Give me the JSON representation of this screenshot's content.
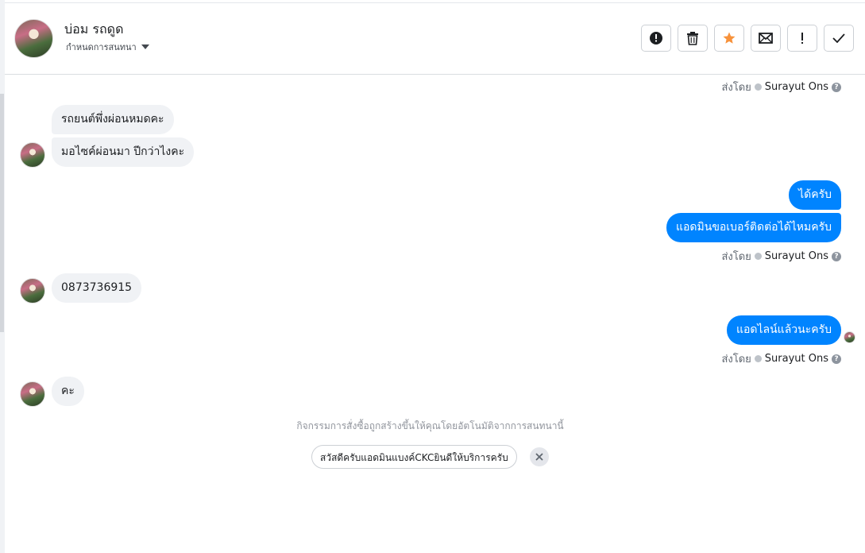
{
  "header": {
    "contact_name": "บ่อม รถดูด",
    "assign_label": "กำหนดการสนทนา",
    "avatar_icon": "user-avatar"
  },
  "toolbar": [
    {
      "name": "spam-button",
      "icon": "alert-circle-icon",
      "title": ""
    },
    {
      "name": "delete-button",
      "icon": "trash-icon",
      "title": ""
    },
    {
      "name": "star-button",
      "icon": "star-icon",
      "title": ""
    },
    {
      "name": "mark-unread-button",
      "icon": "envelope-icon",
      "title": ""
    },
    {
      "name": "follow-up-button",
      "icon": "exclamation-icon",
      "title": ""
    },
    {
      "name": "mark-done-button",
      "icon": "checkmark-icon",
      "title": ""
    }
  ],
  "sent_by_prefix": "ส่งโดย",
  "sent_by_agent": "Surayut Ons",
  "messages": {
    "m1": "รถยนต์พึ่งผ่อนหมดคะ",
    "m2": "มอไซค์ผ่อนมา ปีกว่าไงคะ",
    "m3": "ได้ครับ",
    "m4": "แอดมินขอเบอร์ติดต่อได้ไหมครับ",
    "m5": "0873736915",
    "m6": "แอดไลน์แล้วนะครับ",
    "m7": "คะ"
  },
  "activity_note": "กิจกรรมการสั่งซื้อถูกสร้างขึ้นให้คุณโดยอัตโนมัติจากการสนทนานี้",
  "quick_reply": "สวัสดีครับแอดมินแบงค์CKCยินดีให้บริการครับ",
  "colors": {
    "outgoing_bubble": "#0084ff",
    "incoming_bubble": "#f0f2f5",
    "star": "#f7923b"
  }
}
